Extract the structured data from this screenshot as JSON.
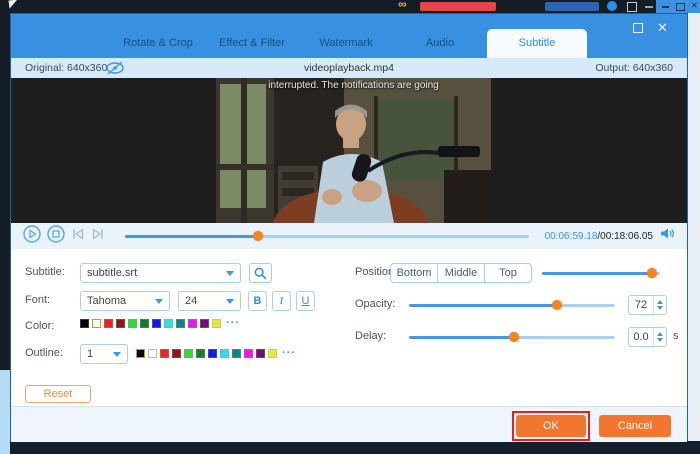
{
  "icons": {
    "close": "✕",
    "more_colors": "···"
  },
  "tabs": [
    {
      "label": "Rotate & Crop"
    },
    {
      "label": "Effect & Filter"
    },
    {
      "label": "Watermark"
    },
    {
      "label": "Audio"
    },
    {
      "label": "Subtitle"
    }
  ],
  "info_bar": {
    "original": "Original: 640x360",
    "filename": "videoplayback.mp4",
    "output": "Output: 640x360"
  },
  "video": {
    "subtitle_text": "interrupted. The notifications are going"
  },
  "player": {
    "current_time": "00:06:59.18",
    "total_time": "/00:18:06.05",
    "progress_percent": 33
  },
  "controls": {
    "subtitle_label": "Subtitle:",
    "subtitle_file": "subtitle.srt",
    "font_label": "Font:",
    "font_family": "Tahoma",
    "font_size": "24",
    "bold": "B",
    "italic": "I",
    "underline": "U",
    "color_label": "Color:",
    "outline_label": "Outline:",
    "outline_width": "1",
    "swatches": [
      "#000000",
      "#ffffff",
      "#e8251f",
      "#8c1613",
      "#3bd439",
      "#1e7a1e",
      "#1a18e0",
      "#35dede",
      "#188080",
      "#e619e6",
      "#6e106c",
      "#e8e838"
    ],
    "color_selected_index": 1,
    "outline_selected_index": 0,
    "position_label": "Position:",
    "position_options": [
      "Bottom",
      "Middle",
      "Top"
    ],
    "position_percent": 93,
    "opacity_label": "Opacity:",
    "opacity_value": "72",
    "opacity_percent": 72,
    "delay_label": "Delay:",
    "delay_value": "0.0",
    "delay_unit": "s",
    "delay_percent": 51
  },
  "footer": {
    "reset": "Reset",
    "ok": "OK",
    "cancel": "Cancel"
  },
  "colors": {
    "accent_blue": "#3990e0",
    "knob_orange": "#f5861f",
    "button_orange": "#f2762d",
    "annotation_red": "#e3201b"
  }
}
